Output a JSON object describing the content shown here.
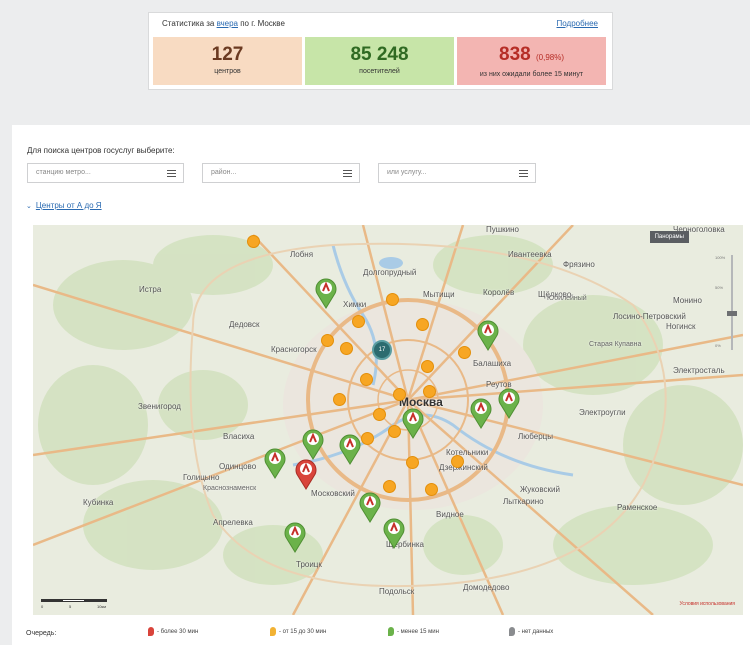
{
  "stats": {
    "prefix": "Статистика за ",
    "link": "вчера",
    "suffix": " по г. Москве",
    "more": "Подробнее",
    "centers": {
      "value": "127",
      "label": "центров"
    },
    "visitors": {
      "value": "85 248",
      "label": "посетителей"
    },
    "waited": {
      "value": "838",
      "percent": "(0,98%)",
      "label": "из них ожидали более 15 минут"
    }
  },
  "search": {
    "prompt": "Для поиска центров госуслуг выберите:",
    "metro_placeholder": "станцию метро...",
    "district_placeholder": "район...",
    "service_placeholder": "или услугу..."
  },
  "az_link": "Центры от А до Я",
  "map": {
    "panorama": "Панорамы",
    "scale": [
      "0",
      "5",
      "10км"
    ],
    "zoom_ticks": [
      "100%",
      "50%",
      "0%"
    ],
    "terms": "Условия использования",
    "places": [
      "Москва",
      "Химки",
      "Долгопрудный",
      "Мытищи",
      "Королёв",
      "Щёлково",
      "Фрязино",
      "Ивантеевка",
      "Пушкино",
      "Черноголовка",
      "Лобня",
      "Истра",
      "Дедовск",
      "Красногорск",
      "Звенигород",
      "Власиха",
      "Одинцово",
      "Голицыно",
      "Кубинка",
      "Краснознаменск",
      "Апрелевка",
      "Московский",
      "Троицк",
      "Щербинка",
      "Подольск",
      "Домодедово",
      "Видное",
      "Котельники",
      "Дзержинский",
      "Лыткарино",
      "Жуковский",
      "Раменское",
      "Люберцы",
      "Реутов",
      "Балашиха",
      "Электроугли",
      "Старая Купавна",
      "Лосино-Петровский",
      "Ногинск",
      "Электросталь",
      "Юбилейный",
      "Монино"
    ],
    "cluster_label": "17"
  },
  "legend": {
    "title": "Очередь:",
    "items": [
      "- более 30 мин",
      "- от 15 до 30 мин",
      "- менее 15 мин",
      "- нет данных"
    ],
    "colors": [
      "#d9443b",
      "#f2b233",
      "#6bb24a",
      "#8a8c8f"
    ]
  },
  "colors": {
    "link": "#2a6ab1",
    "centers_bg": "#f8dbc2",
    "visitors_bg": "#c7e5a8",
    "waited_bg": "#f3b5b2"
  }
}
